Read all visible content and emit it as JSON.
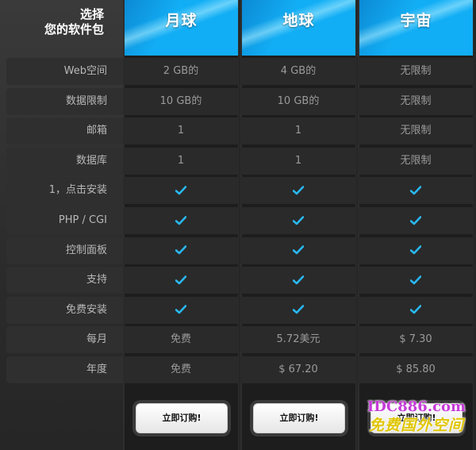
{
  "header": {
    "title_line1": "选择",
    "title_line2": "您的软件包",
    "plans": [
      "月球",
      "地球",
      "宇宙"
    ]
  },
  "rows": [
    {
      "label": "Web空间",
      "values": [
        "2 GB的",
        "4 GB的",
        "无限制"
      ]
    },
    {
      "label": "数据限制",
      "values": [
        "10 GB的",
        "10 GB的",
        "无限制"
      ]
    },
    {
      "label": "邮箱",
      "values": [
        "1",
        "1",
        "无限制"
      ]
    },
    {
      "label": "数据库",
      "values": [
        "1",
        "1",
        "无限制"
      ]
    },
    {
      "label": "1，点击安装",
      "values": [
        "check",
        "check",
        "check"
      ]
    },
    {
      "label": "PHP / CGI",
      "values": [
        "check",
        "check",
        "check"
      ]
    },
    {
      "label": "控制面板",
      "values": [
        "check",
        "check",
        "check"
      ]
    },
    {
      "label": "支持",
      "values": [
        "check",
        "check",
        "check"
      ]
    },
    {
      "label": "免费安装",
      "values": [
        "check",
        "check",
        "check"
      ]
    },
    {
      "label": "每月",
      "values": [
        "免费",
        "5.72美元",
        "$ 7.30"
      ]
    },
    {
      "label": "年度",
      "values": [
        "免费",
        "$ 67.20",
        "$ 85.80"
      ]
    }
  ],
  "buttons": [
    "立即订购!",
    "立即订购!",
    "立即订购!"
  ],
  "watermark": {
    "line1": "IDC886.com",
    "line2": "免费国外空间"
  },
  "colors": {
    "accent": "#12aef5",
    "check": "#29b8f0"
  }
}
